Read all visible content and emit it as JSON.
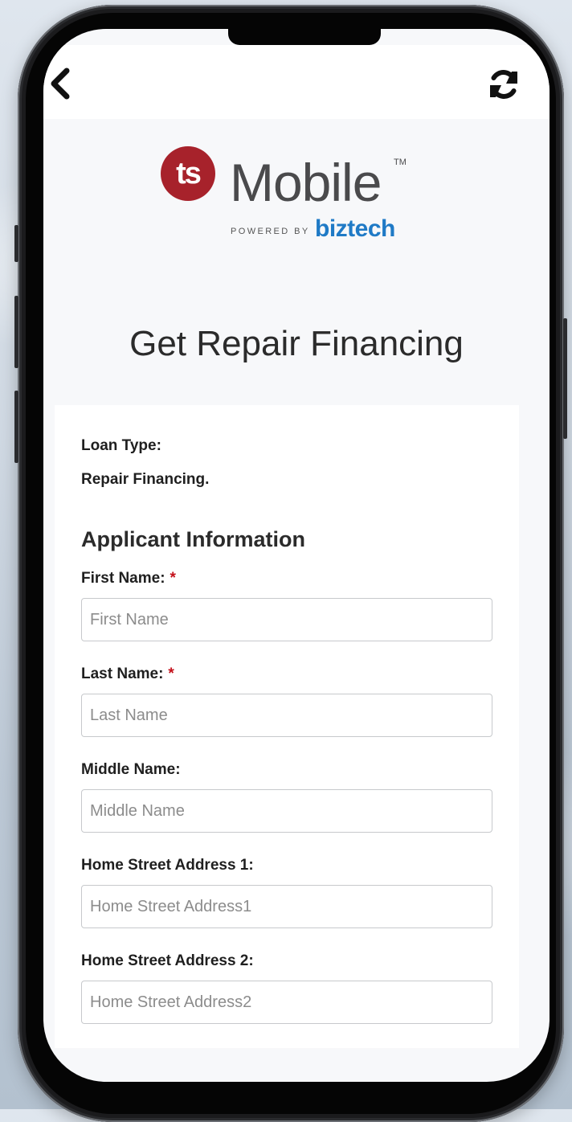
{
  "header": {
    "back_icon": "chevron-left-icon",
    "refresh_icon": "refresh-icon"
  },
  "logo": {
    "badge": "ts",
    "name": "Mobile",
    "trademark": "TM",
    "powered_by": "POWERED BY",
    "brand": "biztech",
    "colors": {
      "badge": "#a7222b",
      "brand": "#1f7ac6"
    }
  },
  "page": {
    "title": "Get Repair Financing"
  },
  "form": {
    "loan_type_label": "Loan Type:",
    "loan_type_value": "Repair Financing.",
    "section_title": "Applicant Information",
    "required_marker": "*",
    "fields": {
      "first_name": {
        "label": "First Name:",
        "placeholder": "First Name",
        "required": true
      },
      "last_name": {
        "label": "Last Name:",
        "placeholder": "Last Name",
        "required": true
      },
      "middle_name": {
        "label": "Middle Name:",
        "placeholder": "Middle Name",
        "required": false
      },
      "address1": {
        "label": "Home Street Address 1:",
        "placeholder": "Home Street Address1",
        "required": false
      },
      "address2": {
        "label": "Home Street Address 2:",
        "placeholder": "Home Street Address2",
        "required": false
      }
    }
  }
}
